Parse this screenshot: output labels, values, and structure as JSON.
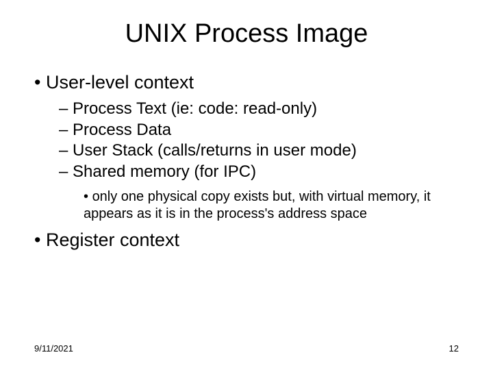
{
  "title": "UNIX Process Image",
  "bullets": {
    "user_level": "User-level context",
    "sub": {
      "a": "Process Text (ie: code: read-only)",
      "b": "Process Data",
      "c": "User Stack (calls/returns in user mode)",
      "d": "Shared memory (for IPC)"
    },
    "subsub": "only one physical copy exists but, with virtual memory, it appears as it is in the process's address space",
    "register": "Register context"
  },
  "footer": {
    "date": "9/11/2021",
    "page": "12"
  }
}
